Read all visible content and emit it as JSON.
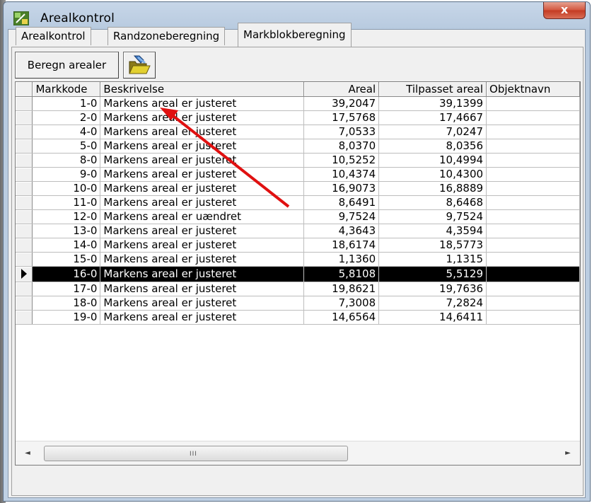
{
  "window": {
    "title": "Arealkontrol",
    "close_symbol": "x"
  },
  "tabs": [
    {
      "label": "Arealkontrol",
      "active": false
    },
    {
      "label": "Randzoneberegning",
      "active": false
    },
    {
      "label": "Markblokberegning",
      "active": true
    }
  ],
  "toolbar": {
    "calc_label": "Beregn arealer",
    "open_icon": "folder-open-icon"
  },
  "table": {
    "columns": [
      "Markkode",
      "Beskrivelse",
      "Areal",
      "Tilpasset areal",
      "Objektnavn"
    ],
    "rows": [
      [
        "1-0",
        "Markens areal er justeret",
        "39,2047",
        "39,1399",
        ""
      ],
      [
        "2-0",
        "Markens areal er justeret",
        "17,5768",
        "17,4667",
        ""
      ],
      [
        "4-0",
        "Markens areal er justeret",
        "7,0533",
        "7,0247",
        ""
      ],
      [
        "5-0",
        "Markens areal er justeret",
        "8,0370",
        "8,0356",
        ""
      ],
      [
        "8-0",
        "Markens areal er justeret",
        "10,5252",
        "10,4994",
        ""
      ],
      [
        "9-0",
        "Markens areal er justeret",
        "10,4374",
        "10,4300",
        ""
      ],
      [
        "10-0",
        "Markens areal er justeret",
        "16,9073",
        "16,8889",
        ""
      ],
      [
        "11-0",
        "Markens areal er justeret",
        "8,6491",
        "8,6468",
        ""
      ],
      [
        "12-0",
        "Markens areal er uændret",
        "9,7524",
        "9,7524",
        ""
      ],
      [
        "13-0",
        "Markens areal er justeret",
        "4,3643",
        "4,3594",
        ""
      ],
      [
        "14-0",
        "Markens areal er justeret",
        "18,6174",
        "18,5773",
        ""
      ],
      [
        "15-0",
        "Markens areal er justeret",
        "1,1360",
        "1,1315",
        ""
      ],
      [
        "16-0",
        "Markens areal er justeret",
        "5,8108",
        "5,5129",
        ""
      ],
      [
        "17-0",
        "Markens areal er justeret",
        "19,8621",
        "19,7636",
        ""
      ],
      [
        "18-0",
        "Markens areal er justeret",
        "7,3008",
        "7,2824",
        ""
      ],
      [
        "19-0",
        "Markens areal er justeret",
        "14,6564",
        "14,6411",
        ""
      ]
    ],
    "selected_row": 12
  },
  "scrollbar": {
    "left_symbol": "◄",
    "right_symbol": "►",
    "grip": "III"
  },
  "colors": {
    "annotation_arrow": "#e01010",
    "selection": "#000000"
  }
}
